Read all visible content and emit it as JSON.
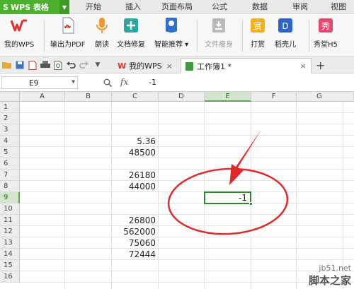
{
  "app": {
    "name": "WPS 表格"
  },
  "menu_tabs": [
    "开始",
    "插入",
    "页面布局",
    "公式",
    "数据",
    "审阅",
    "视图"
  ],
  "ribbon": {
    "my_wps": "我的WPS",
    "export_pdf": "输出为PDF",
    "read_aloud": "朗读",
    "doc_repair": "文档修复",
    "smart_recommend": "智能推荐",
    "file_slim": "文件瘦身",
    "reward": "打赏",
    "daoke": "稻壳儿",
    "show_h5": "秀堂H5"
  },
  "doc_tabs": {
    "home_tab": "我的WPS",
    "doc_tab": "工作簿1 *"
  },
  "formula_bar": {
    "cell_ref": "E9",
    "fx_label": "fx",
    "value": "-1"
  },
  "columns": [
    "A",
    "B",
    "C",
    "D",
    "E",
    "F",
    "G"
  ],
  "rows": [
    "1",
    "2",
    "3",
    "4",
    "5",
    "6",
    "7",
    "8",
    "9",
    "10",
    "11",
    "12",
    "13",
    "14",
    "15",
    "16"
  ],
  "cells": {
    "C4": "5.36",
    "C5": "48500",
    "C7": "26180",
    "C8": "44000",
    "E9": "-1",
    "C11": "26800",
    "C12": "562000",
    "C13": "75060",
    "C14": "72444"
  },
  "selected": {
    "column": "E",
    "row": "9"
  },
  "colors": {
    "wps_green": "#4bb02d",
    "annotation_red": "#e02a2a",
    "selection_green": "#2f8a2f"
  },
  "watermark": {
    "site": "jb51.net",
    "brand": "脚本之家"
  }
}
